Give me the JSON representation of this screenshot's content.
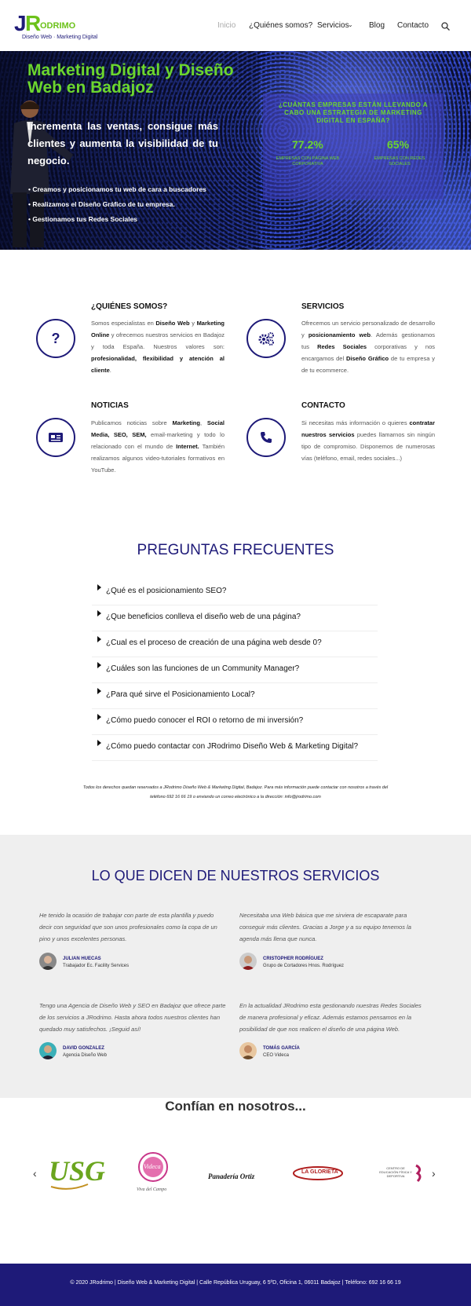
{
  "header": {
    "logo": {
      "letters_j": "J",
      "letters_r": "R",
      "letters_rest": "ODRIMO",
      "tagline": "Diseño Web · Marketing Digital"
    },
    "nav": [
      "Inicio",
      "¿Quiénes somos?",
      "Servicios",
      "Blog",
      "Contacto"
    ]
  },
  "hero": {
    "title": "Marketing Digital y Diseño Web en Badajoz",
    "subtitle": "Incrementa las ventas, consigue más clientes y aumenta la visibilidad de tu negocio.",
    "bullets": [
      "Creamos y posicionamos tu web de cara a buscadores",
      "Realizamos el Diseño Gráfico de  tu empresa.",
      "Gestionamos tus Redes Sociales"
    ],
    "stats_question": "¿CUÁNTAS EMPRESAS ESTÁN LLEVANDO A CABO UNA ESTRATEGIA DE MARKETING DIGITAL EN ESPAÑA?",
    "stat1_value": "77.2%",
    "stat1_label": "EMPRESAS CON PÁGINA WEB CORPORATIVA",
    "stat2_value": "65%",
    "stat2_label": "EMPRESAS CON REDES SOCIALES"
  },
  "features": {
    "about": {
      "title": "¿QUIÉNES SOMOS?",
      "p1": "Somos especialistas en ",
      "b1": "Diseño Web",
      "p2": " y ",
      "b2": "Marketing Online",
      "p3": " y ofrecemos nuestros servicios en Badajoz y toda España. Nuestros valores son: ",
      "b3": "profesionalidad, flexibilidad y atención al cliente",
      "p4": "."
    },
    "services": {
      "title": "SERVICIOS",
      "p1": "Ofrecemos un servicio personalizado de desarrollo y ",
      "b1": "posicionamiento web",
      "p2": ". Además gestionamos tus ",
      "b2": "Redes Sociales",
      "p3": " corporativas y nos encargamos del ",
      "b3": "Diseño Gráfico",
      "p4": " de tu empresa y de tu ecommerce."
    },
    "news": {
      "title": "NOTICIAS",
      "p1": "Publicamos noticias sobre ",
      "b1": "Marketing",
      "p2": ", ",
      "b2": "Social Media, SEO, SEM,",
      "p3": " email-marketing y todo lo relacionado con el mundo de ",
      "b3": "Internet.",
      "p4": " También realizamos algunos video-tutoriales formativos en YouTube."
    },
    "contact": {
      "title": "CONTACTO",
      "p1": "Si necesitas más información o quieres ",
      "b1": "contratar nuestros servicios",
      "p2": " puedes llamarnos sin ningún tipo de compromiso. Disponemos de numerosas vías (teléfono, email, redes sociales...)"
    }
  },
  "faq": {
    "title": "PREGUNTAS FRECUENTES",
    "items": [
      "¿Qué es el posicionamiento SEO?",
      "¿Que beneficios conlleva el diseño web de una página?",
      "¿Cual es el proceso de creación de una página web desde 0?",
      "¿Cuáles son las funciones de un Community Manager?",
      "¿Para qué sirve el Posicionamiento Local?",
      "¿Cómo puedo conocer el ROI o retorno de mi inversión?",
      "¿Cómo puedo contactar con JRodrimo Diseño Web & Marketing Digital?"
    ],
    "legal": "Todos los derechos quedan reservados a JRodrimo Diseño Web & Marketing Digital, Badajoz. Para más información puede contactar con nosotros a través del teléfono  692 16 66 19 o enviando un correo electrónico a la dirección:  info@jrodrimo.com"
  },
  "testimonials": {
    "title": "LO QUE DICEN DE NUESTROS SERVICIOS",
    "items": [
      {
        "quote": "He tenido la ocasión de trabajar con parte de esta plantilla y puedo decir con seguridad que son unos profesionales como la copa de un pino y unos excelentes personas.",
        "name": "JULIAN HUECAS",
        "role": "Trabajador Ec. Facility Services"
      },
      {
        "quote": "Necesitaba una Web básica que me sirviera de escaparate para conseguir más clientes. Gracias a Jorge y a su equipo tenemos la agenda más llena que nunca.",
        "name": "CRISTOPHER RODRÍGUEZ",
        "role": "Grupo de Cortadores Hnos. Rodríguez"
      },
      {
        "quote": "Tengo una Agencia de Diseño Web y SEO en Badajoz que ofrece parte de los servicios a JRodrimo. Hasta ahora todos nuestros clientes han quedado muy satisfechos. ¡Seguid así!",
        "name": "DAVID GONZALEZ",
        "role": "Agencia Diseño Web"
      },
      {
        "quote": "En la actualidad JRodrimo esta gestionando nuestras Redes Sociales de manera profesional y eficaz. Además estamos pensamos en la posibilidad de que nos realicen el diseño de una página Web.",
        "name": "TOMÁS GARCÍA",
        "role": "CEO Videca"
      }
    ]
  },
  "trust": {
    "title": "Confían en nosotros...",
    "logos": [
      "USG",
      "Videca",
      "Viva del Campo",
      "Panadería Ortiz",
      "LA GLORIETA",
      "CENTRO DE EDUCACIÓN FÍSICA Y DEPORTIVA"
    ]
  },
  "footer": {
    "text": "© 2020 JRodrimo | Diseño Web & Marketing Digital | Calle República Uruguay, 6 5ºD, Oficina 1, 06011 Badajoz | Teléfono: 692 16 66 19"
  },
  "colors": {
    "brand_navy": "#1e1a78",
    "brand_green": "#6cc21a"
  }
}
